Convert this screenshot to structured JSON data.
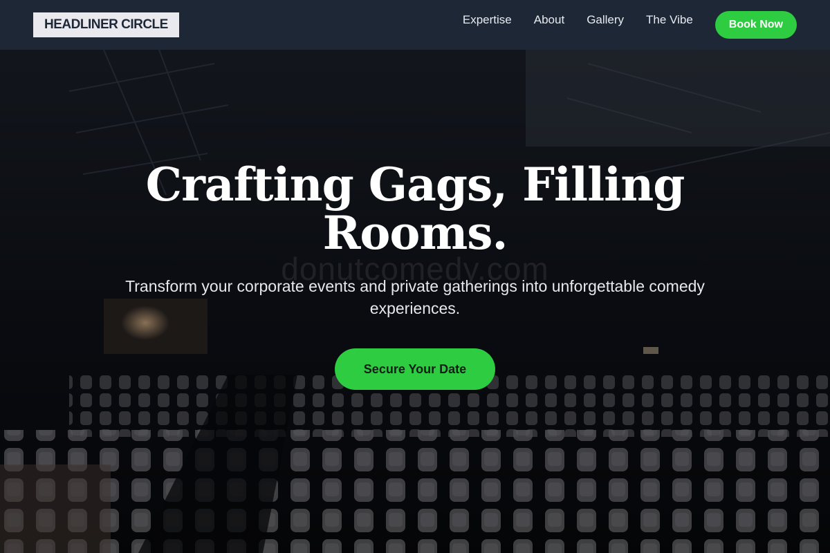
{
  "header": {
    "logo": "HEADLINER CIRCLE",
    "nav": [
      {
        "label": "Expertise"
      },
      {
        "label": "About"
      },
      {
        "label": "Gallery"
      },
      {
        "label": "The Vibe"
      }
    ],
    "cta_label": "Book Now"
  },
  "hero": {
    "title": "Crafting Gags, Filling Rooms.",
    "subtitle": "Transform your corporate events and private gatherings into unforgettable comedy experiences.",
    "cta_label": "Secure Your Date",
    "watermark": "donutcomedy.com"
  },
  "colors": {
    "header_bg": "#1e2736",
    "accent_green": "#2ecc40",
    "logo_bg": "#e9e9ee"
  }
}
